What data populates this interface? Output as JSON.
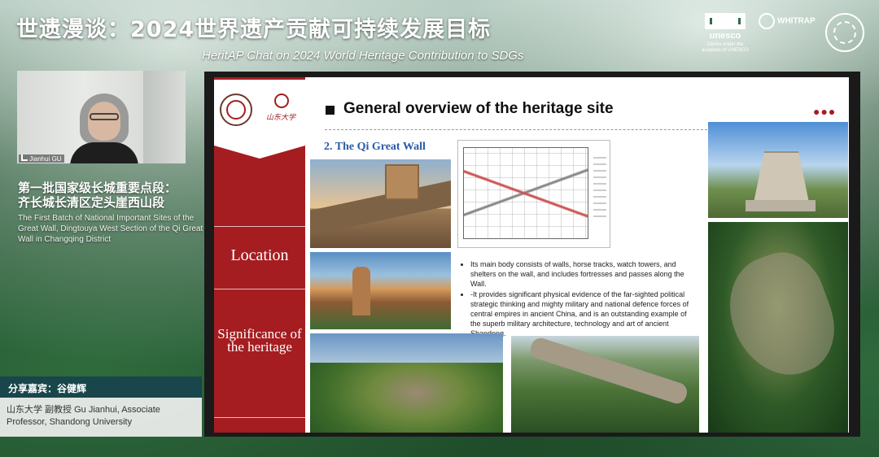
{
  "event": {
    "title_cn": "世遗漫谈：2024世界遗产贡献可持续发展目标",
    "title_en": "HeritAP Chat on 2024 World Heritage Contribution to SDGs"
  },
  "logos": {
    "unesco": "unesco",
    "unesco_sub": "Centre under the auspices of UNESCO",
    "whitrap": "WHITRAP"
  },
  "webcam": {
    "name": "Jianhui GU"
  },
  "site": {
    "title_cn_line1": "第一批国家级长城重要点段：",
    "title_cn_line2": "齐长城长清区定头崖西山段",
    "title_en": "The First Batch of National Important Sites of the Great Wall, Dingtouya West Section of the Qi Great Wall in Changqing District"
  },
  "speaker": {
    "label": "分享嘉宾：谷健辉",
    "info": "山东大学 副教授 Gu Jianhui, Associate Professor, Shandong University"
  },
  "slide": {
    "heading": "General overview of the heritage site",
    "subheading": "2. The Qi Great Wall",
    "sidebar_location": "Location",
    "sidebar_significance": "Significance of the heritage",
    "emblem_text": "山东大学",
    "dots": "●●●",
    "bullets": [
      "Its main body consists of walls, horse tracks, watch towers, and shelters on the wall, and includes fortresses and passes along the Wall.",
      "-It provides significant physical evidence of the far-sighted political strategic thinking and mighty military and national defence forces of central empires in ancient China, and is an outstanding example of the superb military architecture, technology and art of ancient Shandong."
    ]
  },
  "colors": {
    "sidebar_red": "#a51d20",
    "subheading_blue": "#2a5aa6",
    "speaker_bar": "#16424e"
  }
}
